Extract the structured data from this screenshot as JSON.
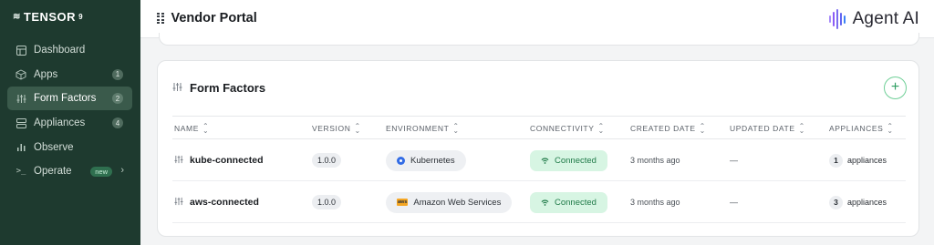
{
  "brand": {
    "name": "TENSOR",
    "superscript": "9"
  },
  "sidebar": {
    "items": [
      {
        "label": "Dashboard",
        "icon": "dashboard-icon"
      },
      {
        "label": "Apps",
        "icon": "cube-icon",
        "count": "1"
      },
      {
        "label": "Form Factors",
        "icon": "sliders-icon",
        "count": "2",
        "active": true
      },
      {
        "label": "Appliances",
        "icon": "server-icon",
        "count": "4"
      },
      {
        "label": "Observe",
        "icon": "bar-chart-icon"
      },
      {
        "label": "Operate",
        "icon": "terminal-icon",
        "badge": "new"
      }
    ]
  },
  "header": {
    "title": "Vendor Portal",
    "logo_text": "Agent AI"
  },
  "card": {
    "title": "Form Factors",
    "add_label": "+"
  },
  "table": {
    "columns": [
      "NAME",
      "VERSION",
      "ENVIRONMENT",
      "CONNECTIVITY",
      "CREATED DATE",
      "UPDATED DATE",
      "APPLIANCES"
    ],
    "rows": [
      {
        "name": "kube-connected",
        "version": "1.0.0",
        "environment": "Kubernetes",
        "connectivity": "Connected",
        "created": "3 months ago",
        "updated": "—",
        "appliances_count": "1",
        "appliances_label": "appliances"
      },
      {
        "name": "aws-connected",
        "version": "1.0.0",
        "environment": "Amazon Web Services",
        "env_logo": "aws",
        "connectivity": "Connected",
        "created": "3 months ago",
        "updated": "—",
        "appliances_count": "3",
        "appliances_label": "appliances"
      }
    ]
  },
  "colors": {
    "sidebar_bg": "#1e3a2f",
    "accent_green": "#2f9e62",
    "connected_bg": "#d7f5e3",
    "logo_wave": [
      "#8b5cf6",
      "#6366f1",
      "#3b82f6"
    ]
  }
}
